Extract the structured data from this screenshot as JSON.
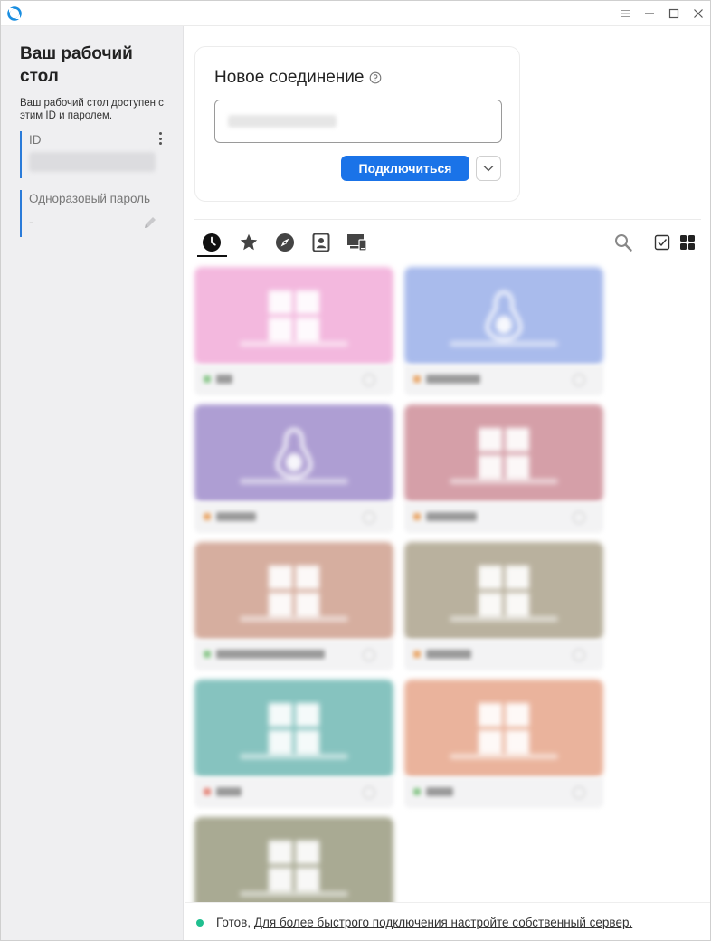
{
  "window": {
    "accent_color": "#1a73e8",
    "icons": [
      "app-logo-icon",
      "menu-icon",
      "minimize-icon",
      "maximize-icon",
      "close-icon"
    ]
  },
  "sidebar": {
    "title": "Ваш рабочий стол",
    "description": "Ваш рабочий стол доступен с этим ID и паролем.",
    "id_label": "ID",
    "password_label": "Одноразовый пароль",
    "password_value": "-"
  },
  "connect": {
    "title": "Новое соединение",
    "button_label": "Подключиться"
  },
  "tabs": [
    {
      "name": "recent",
      "icon": "clock-icon",
      "active": true
    },
    {
      "name": "favorites",
      "icon": "star-icon",
      "active": false
    },
    {
      "name": "discovered",
      "icon": "compass-icon",
      "active": false
    },
    {
      "name": "address-book",
      "icon": "contact-book-icon",
      "active": false
    },
    {
      "name": "lan",
      "icon": "devices-icon",
      "active": false
    }
  ],
  "peers": [
    {
      "color": "#f3b8de",
      "os": "windows",
      "status_color": "#8bc78b"
    },
    {
      "color": "#a9bbec",
      "os": "linux",
      "status_color": "#e9a86b"
    },
    {
      "color": "#ae9ed3",
      "os": "linux",
      "status_color": "#e9a86b"
    },
    {
      "color": "#d59fa8",
      "os": "windows",
      "status_color": "#e9a86b"
    },
    {
      "color": "#d6ae9f",
      "os": "windows",
      "status_color": "#8bc78b"
    },
    {
      "color": "#b9b19e",
      "os": "windows",
      "status_color": "#e9a86b"
    },
    {
      "color": "#86c3bf",
      "os": "windows",
      "status_color": "#e58a7e"
    },
    {
      "color": "#eab39c",
      "os": "windows",
      "status_color": "#8bc78b"
    },
    {
      "color": "#a9aa93",
      "os": "windows",
      "status_color": "#8bc78b"
    }
  ],
  "status": {
    "text": "Готов,",
    "link": "Для более быстрого подключения настройте собственный сервер.",
    "dot_color": "#1fbf8f"
  }
}
